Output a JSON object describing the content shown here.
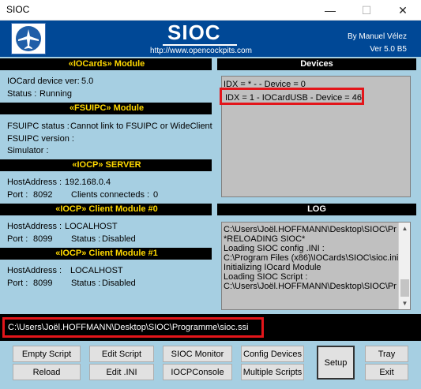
{
  "window": {
    "title": "SIOC",
    "minimize": "—",
    "maximize": "☐",
    "close": "✕"
  },
  "header": {
    "app_name": "SIOC",
    "url": "http://www.opencockpits.com",
    "author": "By Manuel Vélez",
    "version": "Ver 5.0 B5"
  },
  "iocards": {
    "title": "«IOCards» Module",
    "device_ver_label": "IOCard device ver:",
    "device_ver_value": "5.0",
    "status_label": "Status :",
    "status_value": "Running"
  },
  "fsuipc": {
    "title": "«FSUIPC» Module",
    "status_label": "FSUIPC status :",
    "status_value": "Cannot link to FSUIPC or WideClient",
    "version_label": "FSUIPC version :",
    "simulator_label": "Simulator :"
  },
  "iocp_server": {
    "title": "«IOCP» SERVER",
    "host_label": "HostAddress :",
    "host_value": "192.168.0.4",
    "port_label": "Port :",
    "port_value": "8092",
    "clients_label": "Clients connecteds :",
    "clients_value": "0"
  },
  "client0": {
    "title": "«IOCP» Client Module #0",
    "host_label": "HostAddress :",
    "host_value": "LOCALHOST",
    "port_label": "Port :",
    "port_value": "8099",
    "status_label": "Status :",
    "status_value": "Disabled"
  },
  "client1": {
    "title": "«IOCP» Client Module #1",
    "host_label": "HostAddress :",
    "host_value": "LOCALHOST",
    "port_label": "Port :",
    "port_value": "8099",
    "status_label": "Status :",
    "status_value": "Disabled"
  },
  "devices": {
    "title": "Devices",
    "items": [
      "IDX = * -  - Device = 0",
      "IDX = 1 - IOCardUSB - Device = 46"
    ]
  },
  "log": {
    "title": "LOG",
    "lines": [
      "C:\\Users\\Joël.HOFFMANN\\Desktop\\SIOC\\Pr",
      "*RELOADING SIOC*",
      "Loading SIOC config .INI :",
      "C:\\Program Files (x86)\\IOCards\\SIOC\\sioc.ini",
      "Initializing IOcard Module",
      "Loading SIOC Script :",
      "C:\\Users\\Joël.HOFFMANN\\Desktop\\SIOC\\Pr"
    ]
  },
  "script_path": "C:\\Users\\Joël.HOFFMANN\\Desktop\\SIOC\\Programme\\sioc.ssi",
  "buttons": {
    "empty_script": "Empty Script",
    "edit_script": "Edit Script",
    "sioc_monitor": "SIOC Monitor",
    "config_devices": "Config Devices",
    "setup": "Setup",
    "tray": "Tray",
    "reload": "Reload",
    "edit_ini": "Edit .INI",
    "iocp_console": "IOCPConsole",
    "multiple_scripts": "Multiple Scripts",
    "exit": "Exit"
  },
  "colors": {
    "client_bg": "#a6cfe2",
    "header_bg": "#004896",
    "section_text": "#ffd800",
    "highlight": "#e3151a"
  }
}
